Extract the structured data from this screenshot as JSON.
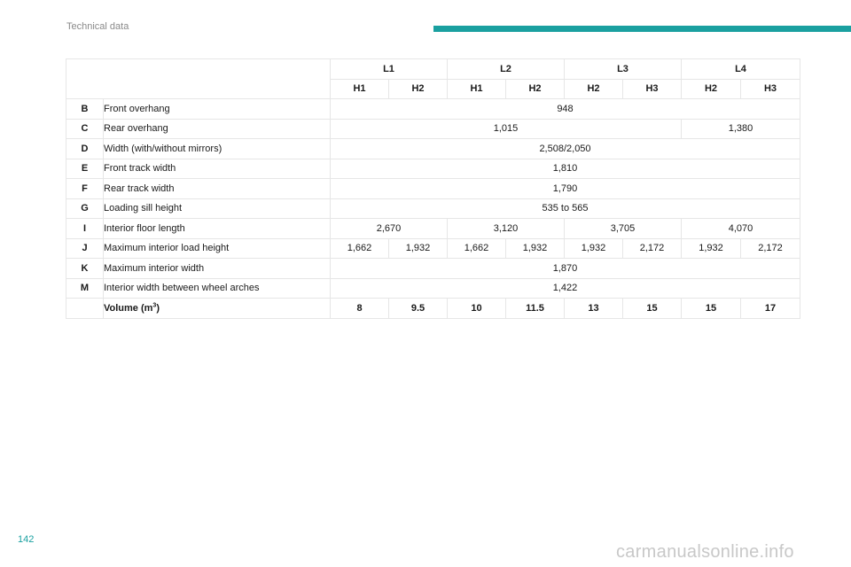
{
  "header": {
    "section_title": "Technical data"
  },
  "table": {
    "lengths": [
      "L1",
      "L2",
      "L3",
      "L4"
    ],
    "heights": [
      "H1",
      "H2",
      "H1",
      "H2",
      "H2",
      "H3",
      "H2",
      "H3"
    ],
    "rows": {
      "B": {
        "letter": "B",
        "label": "Front overhang",
        "value": "948"
      },
      "C": {
        "letter": "C",
        "label": "Rear overhang",
        "v1": "1,015",
        "v2": "1,380"
      },
      "D": {
        "letter": "D",
        "label": "Width (with/without mirrors)",
        "value": "2,508/2,050"
      },
      "E": {
        "letter": "E",
        "label": "Front track width",
        "value": "1,810"
      },
      "F": {
        "letter": "F",
        "label": "Rear track width",
        "value": "1,790"
      },
      "G": {
        "letter": "G",
        "label": "Loading sill height",
        "value": "535 to 565"
      },
      "I": {
        "letter": "I",
        "label": "Interior floor length",
        "values": [
          "2,670",
          "3,120",
          "3,705",
          "4,070"
        ]
      },
      "J": {
        "letter": "J",
        "label": "Maximum interior load height",
        "values": [
          "1,662",
          "1,932",
          "1,662",
          "1,932",
          "1,932",
          "2,172",
          "1,932",
          "2,172"
        ]
      },
      "K": {
        "letter": "K",
        "label": "Maximum interior width",
        "value": "1,870"
      },
      "M": {
        "letter": "M",
        "label": "Interior width between wheel arches",
        "value": "1,422"
      },
      "volume": {
        "label": "Volume (m",
        "unit_sup": "3",
        "label_end": ")",
        "values": [
          "8",
          "9.5",
          "10",
          "11.5",
          "13",
          "15",
          "15",
          "17"
        ]
      }
    }
  },
  "footer": {
    "page_number": "142",
    "watermark": "carmanualsonline.info"
  }
}
